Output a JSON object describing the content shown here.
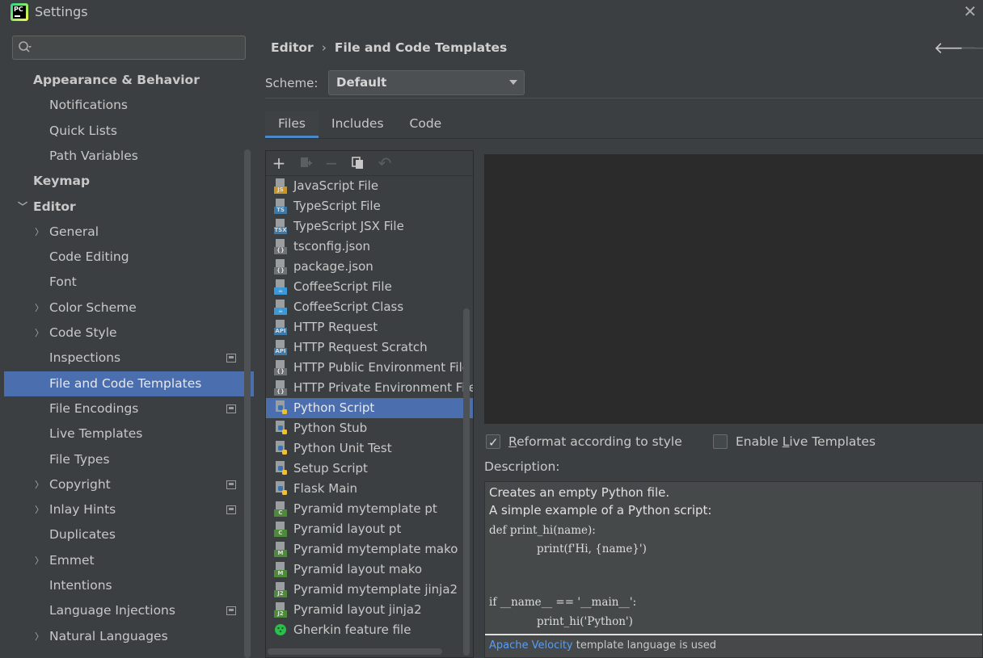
{
  "window": {
    "title": "Settings",
    "app_icon": "pycharm-logo",
    "app_icon_text": "PC"
  },
  "sidebar": {
    "search_placeholder": "",
    "items": [
      {
        "label": "Appearance & Behavior",
        "bold": true,
        "depth": 0,
        "arrow": ""
      },
      {
        "label": "Notifications",
        "depth": 1,
        "arrow": ""
      },
      {
        "label": "Quick Lists",
        "depth": 1,
        "arrow": ""
      },
      {
        "label": "Path Variables",
        "depth": 1,
        "arrow": ""
      },
      {
        "label": "Keymap",
        "bold": true,
        "depth": 0,
        "arrow": ""
      },
      {
        "label": "Editor",
        "bold": true,
        "depth": 0,
        "arrow": "expanded"
      },
      {
        "label": "General",
        "depth": 1,
        "arrow": "collapsed"
      },
      {
        "label": "Code Editing",
        "depth": 1,
        "arrow": ""
      },
      {
        "label": "Font",
        "depth": 1,
        "arrow": ""
      },
      {
        "label": "Color Scheme",
        "depth": 1,
        "arrow": "collapsed"
      },
      {
        "label": "Code Style",
        "depth": 1,
        "arrow": "collapsed"
      },
      {
        "label": "Inspections",
        "depth": 1,
        "arrow": "",
        "badge": true
      },
      {
        "label": "File and Code Templates",
        "depth": 1,
        "arrow": "",
        "selected": true
      },
      {
        "label": "File Encodings",
        "depth": 1,
        "arrow": "",
        "badge": true
      },
      {
        "label": "Live Templates",
        "depth": 1,
        "arrow": ""
      },
      {
        "label": "File Types",
        "depth": 1,
        "arrow": ""
      },
      {
        "label": "Copyright",
        "depth": 1,
        "arrow": "collapsed",
        "badge": true
      },
      {
        "label": "Inlay Hints",
        "depth": 1,
        "arrow": "collapsed",
        "badge": true
      },
      {
        "label": "Duplicates",
        "depth": 1,
        "arrow": ""
      },
      {
        "label": "Emmet",
        "depth": 1,
        "arrow": "collapsed"
      },
      {
        "label": "Intentions",
        "depth": 1,
        "arrow": ""
      },
      {
        "label": "Language Injections",
        "depth": 1,
        "arrow": "",
        "badge": true
      },
      {
        "label": "Natural Languages",
        "depth": 1,
        "arrow": "collapsed"
      }
    ]
  },
  "header": {
    "breadcrumb_parent": "Editor",
    "breadcrumb_separator": "›",
    "breadcrumb_current": "File and Code Templates",
    "back_icon": "arrow-left-icon",
    "forward_icon": "arrow-right-icon"
  },
  "scheme": {
    "label": "Scheme:",
    "value": "Default"
  },
  "tabs": [
    "Files",
    "Includes",
    "Code"
  ],
  "active_tab": "Files",
  "toolbar": [
    "add",
    "copy-template",
    "remove",
    "duplicate",
    "reset"
  ],
  "templates": [
    {
      "label": "JavaScript File",
      "tag": "JS",
      "tag_color": "#c7962a"
    },
    {
      "label": "TypeScript File",
      "tag": "TS",
      "tag_color": "#3d7aa8"
    },
    {
      "label": "TypeScript JSX File",
      "tag": "TSX",
      "tag_color": "#3d7aa8"
    },
    {
      "label": "tsconfig.json",
      "tag": "{}",
      "tag_color": "#6f7375"
    },
    {
      "label": "package.json",
      "tag": "{}",
      "tag_color": "#6f7375"
    },
    {
      "label": "CoffeeScript File",
      "tag": "☕",
      "tag_color": "#3a9ad9"
    },
    {
      "label": "CoffeeScript Class",
      "tag": "☕",
      "tag_color": "#3a9ad9"
    },
    {
      "label": "HTTP Request",
      "tag": "API",
      "tag_color": "#3d7aa8"
    },
    {
      "label": "HTTP Request Scratch",
      "tag": "API",
      "tag_color": "#3d7aa8"
    },
    {
      "label": "HTTP Public Environment File",
      "tag": "{}",
      "tag_color": "#6f7375"
    },
    {
      "label": "HTTP Private Environment File",
      "tag": "{}",
      "tag_color": "#6f7375"
    },
    {
      "label": "Python Script",
      "tag": "py",
      "tag_color": "#3a74b0",
      "selected": true
    },
    {
      "label": "Python Stub",
      "tag": "py",
      "tag_color": "#3a74b0"
    },
    {
      "label": "Python Unit Test",
      "tag": "py",
      "tag_color": "#3a74b0"
    },
    {
      "label": "Setup Script",
      "tag": "py",
      "tag_color": "#3a74b0"
    },
    {
      "label": "Flask Main",
      "tag": "py",
      "tag_color": "#3a74b0"
    },
    {
      "label": "Pyramid mytemplate pt",
      "tag": "C",
      "tag_color": "#4f8a3c"
    },
    {
      "label": "Pyramid layout pt",
      "tag": "C",
      "tag_color": "#4f8a3c"
    },
    {
      "label": "Pyramid mytemplate mako",
      "tag": "M",
      "tag_color": "#4f8a3c"
    },
    {
      "label": "Pyramid layout mako",
      "tag": "M",
      "tag_color": "#4f8a3c"
    },
    {
      "label": "Pyramid mytemplate jinja2",
      "tag": "J2",
      "tag_color": "#4f8a3c"
    },
    {
      "label": "Pyramid layout jinja2",
      "tag": "J2",
      "tag_color": "#4f8a3c"
    },
    {
      "label": "Gherkin feature file",
      "tag": "gherkin",
      "tag_color": "#2bbf4b"
    }
  ],
  "options": {
    "reformat": {
      "prefix": "",
      "underline": "R",
      "rest": "eformat according to style",
      "checked": true
    },
    "live_templates": {
      "prefix": "Enable ",
      "underline": "L",
      "rest": "ive Templates",
      "checked": false
    }
  },
  "description": {
    "label": "Description:",
    "line1": "Creates an empty Python file.",
    "line2": "A simple example of a Python script:",
    "code1": "def print_hi(name):",
    "code2": "print(f'Hi, {name}')",
    "code3": "if __name__ == '__main__':",
    "code4": "print_hi('Python')",
    "footer_link": "Apache Velocity",
    "footer_text": " template language is used"
  }
}
